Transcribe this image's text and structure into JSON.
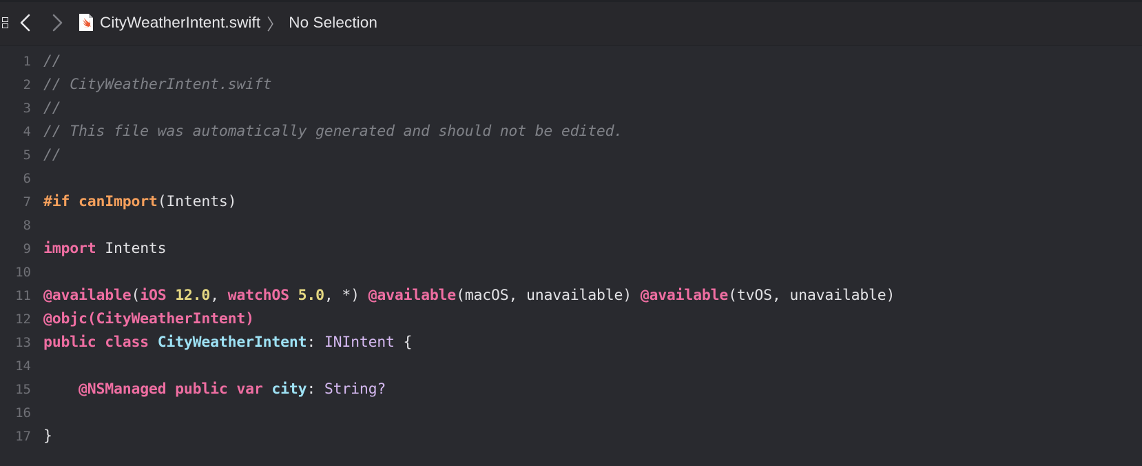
{
  "window": {
    "background": "#292a2f",
    "jumpbar_background": "#28282c"
  },
  "jumpbar": {
    "editor_toggle_name": "editor-options",
    "back_label": "‹",
    "forward_label": "›",
    "file_name": "CityWeatherIntent.swift",
    "separator": "〉",
    "selection_label": "No Selection",
    "file_icon": "swift-file-icon"
  },
  "editor": {
    "line_numbers": [
      "1",
      "2",
      "3",
      "4",
      "5",
      "6",
      "7",
      "8",
      "9",
      "10",
      "11",
      "12",
      "13",
      "14",
      "15",
      "16",
      "17"
    ],
    "colors": {
      "comment": "#7f8187",
      "keyword": "#ef6ea2",
      "directive": "#f6a05c",
      "number": "#e5d882",
      "type": "#9ee2f5",
      "system_type": "#d4b8f0",
      "plain": "#e2e2e5",
      "line_number": "#6f7076"
    },
    "lines": [
      {
        "n": "1",
        "tokens": [
          {
            "t": "comment",
            "v": "//"
          }
        ]
      },
      {
        "n": "2",
        "tokens": [
          {
            "t": "comment",
            "v": "// CityWeatherIntent.swift"
          }
        ]
      },
      {
        "n": "3",
        "tokens": [
          {
            "t": "comment",
            "v": "//"
          }
        ]
      },
      {
        "n": "4",
        "tokens": [
          {
            "t": "comment",
            "v": "// This file was automatically generated and should not be edited."
          }
        ]
      },
      {
        "n": "5",
        "tokens": [
          {
            "t": "comment",
            "v": "//"
          }
        ]
      },
      {
        "n": "6",
        "tokens": []
      },
      {
        "n": "7",
        "tokens": [
          {
            "t": "directive",
            "v": "#if"
          },
          {
            "t": "plain",
            "v": " "
          },
          {
            "t": "directive",
            "v": "canImport"
          },
          {
            "t": "plain",
            "v": "(Intents)"
          }
        ]
      },
      {
        "n": "8",
        "tokens": []
      },
      {
        "n": "9",
        "tokens": [
          {
            "t": "keyword",
            "v": "import"
          },
          {
            "t": "plain",
            "v": " Intents"
          }
        ]
      },
      {
        "n": "10",
        "tokens": []
      },
      {
        "n": "11",
        "tokens": [
          {
            "t": "attr",
            "v": "@available"
          },
          {
            "t": "plain",
            "v": "("
          },
          {
            "t": "attr",
            "v": "iOS"
          },
          {
            "t": "plain",
            "v": " "
          },
          {
            "t": "number",
            "v": "12.0"
          },
          {
            "t": "plain",
            "v": ", "
          },
          {
            "t": "attr",
            "v": "watchOS"
          },
          {
            "t": "plain",
            "v": " "
          },
          {
            "t": "number",
            "v": "5.0"
          },
          {
            "t": "plain",
            "v": ", *) "
          },
          {
            "t": "attr",
            "v": "@available"
          },
          {
            "t": "plain",
            "v": "(macOS, unavailable) "
          },
          {
            "t": "attr",
            "v": "@available"
          },
          {
            "t": "plain",
            "v": "(tvOS, unavailable)"
          }
        ]
      },
      {
        "n": "12",
        "tokens": [
          {
            "t": "attr",
            "v": "@objc(CityWeatherIntent)"
          }
        ]
      },
      {
        "n": "13",
        "tokens": [
          {
            "t": "keyword",
            "v": "public class"
          },
          {
            "t": "plain",
            "v": " "
          },
          {
            "t": "type",
            "v": "CityWeatherIntent"
          },
          {
            "t": "plain",
            "v": ": "
          },
          {
            "t": "systype",
            "v": "INIntent"
          },
          {
            "t": "plain",
            "v": " {"
          }
        ]
      },
      {
        "n": "14",
        "tokens": []
      },
      {
        "n": "15",
        "tokens": [
          {
            "t": "plain",
            "v": "    "
          },
          {
            "t": "keyword",
            "v": "@NSManaged public var"
          },
          {
            "t": "plain",
            "v": " "
          },
          {
            "t": "type",
            "v": "city"
          },
          {
            "t": "plain",
            "v": ": "
          },
          {
            "t": "systype",
            "v": "String?"
          }
        ]
      },
      {
        "n": "16",
        "tokens": []
      },
      {
        "n": "17",
        "tokens": [
          {
            "t": "plain",
            "v": "}"
          }
        ]
      }
    ]
  }
}
